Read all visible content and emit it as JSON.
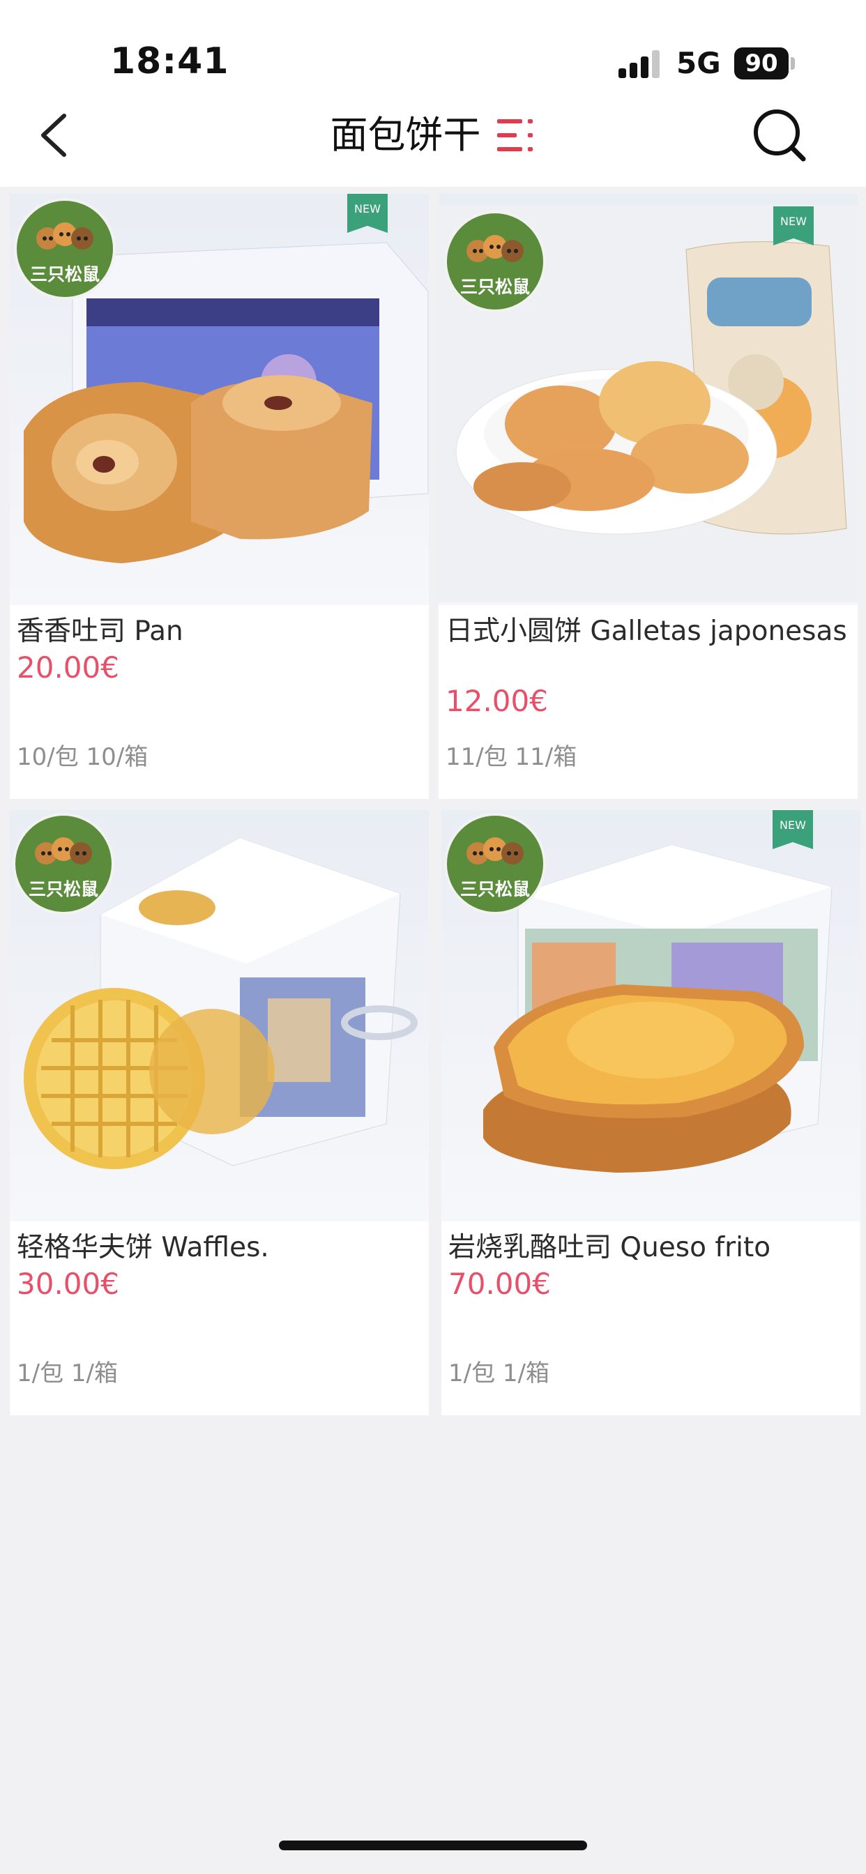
{
  "status_bar": {
    "time": "18:41",
    "network": "5G",
    "battery": "90"
  },
  "nav": {
    "title": "面包饼干",
    "back_icon": "chevron-left-icon",
    "menu_icon": "category-list-icon",
    "search_icon": "search-icon"
  },
  "colors": {
    "price": "#e8506a",
    "menu_accent": "#e23b4d",
    "new_badge": "#3aa17a",
    "brand_logo": "#5a8c3c"
  },
  "products": [
    {
      "name": "香香吐司 Pan",
      "price": "20.00€",
      "pack": "10/包 10/箱",
      "badge": "NEW",
      "brand": "三只松鼠"
    },
    {
      "name": "日式小圆饼 Galletas japonesas",
      "price": "12.00€",
      "pack": "11/包 11/箱",
      "badge": "NEW",
      "brand": "三只松鼠"
    },
    {
      "name": "轻格华夫饼 Waffles.",
      "price": "30.00€",
      "pack": "1/包 1/箱",
      "badge": "",
      "brand": "三只松鼠"
    },
    {
      "name": "岩烧乳酪吐司 Queso frito",
      "price": "70.00€",
      "pack": "1/包 1/箱",
      "badge": "NEW",
      "brand": "三只松鼠"
    }
  ]
}
